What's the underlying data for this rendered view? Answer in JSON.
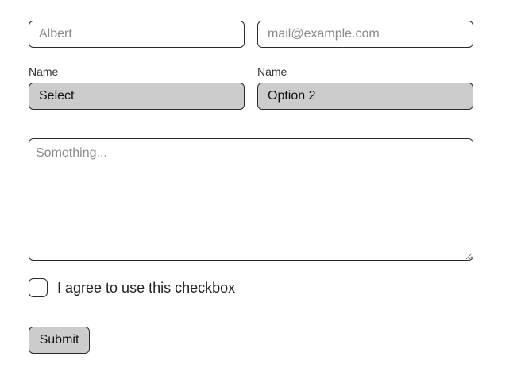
{
  "form": {
    "first_name": {
      "value": "",
      "placeholder": "Albert"
    },
    "email": {
      "value": "",
      "placeholder": "mail@example.com"
    },
    "select_1": {
      "label": "Name",
      "selected": "Select"
    },
    "select_2": {
      "label": "Name",
      "selected": "Option 2"
    },
    "message": {
      "value": "",
      "placeholder": "Something..."
    },
    "checkbox": {
      "label": "I agree to use this checkbox",
      "checked": false
    },
    "submit_label": "Submit"
  },
  "colors": {
    "border": "#2b2b2b",
    "select_background": "#cccccc",
    "placeholder": "#8a8a8a"
  }
}
